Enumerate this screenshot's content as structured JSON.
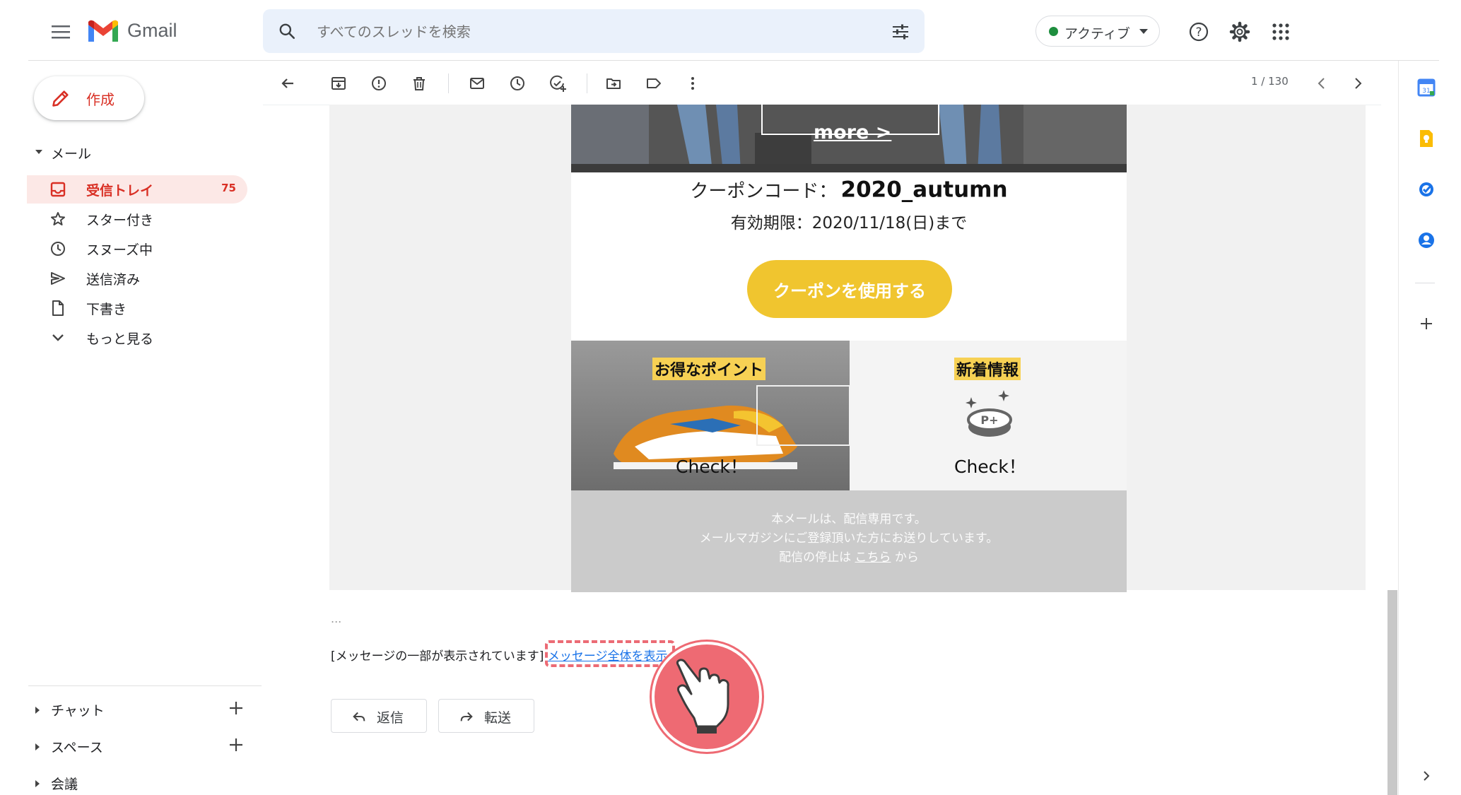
{
  "header": {
    "app_name": "Gmail",
    "search_placeholder": "すべてのスレッドを検索",
    "status_label": "アクティブ"
  },
  "sidebar": {
    "compose_label": "作成",
    "mail_section": "メール",
    "items": [
      {
        "label": "受信トレイ",
        "count": "75",
        "icon": "inbox-icon"
      },
      {
        "label": "スター付き",
        "icon": "star-icon"
      },
      {
        "label": "スヌーズ中",
        "icon": "clock-icon"
      },
      {
        "label": "送信済み",
        "icon": "send-icon"
      },
      {
        "label": "下書き",
        "icon": "draft-icon"
      },
      {
        "label": "もっと見る",
        "icon": "chevron-down-icon"
      }
    ],
    "sections": [
      {
        "label": "チャット"
      },
      {
        "label": "スペース"
      },
      {
        "label": "会議"
      }
    ]
  },
  "toolbar": {
    "page_count": "1 / 130"
  },
  "email": {
    "hero_more": "more >",
    "coupon_label": "クーポンコード：",
    "coupon_code": "2020_autumn",
    "expiry": "有効期限：2020/11/18(日)まで",
    "use_coupon": "クーポンを使用する",
    "promo_left_title": "お得なポイント",
    "promo_left_check": "Check！",
    "promo_right_title": "新着情報",
    "promo_right_check": "Check！",
    "footer_line1": "本メールは、配信専用です。",
    "footer_line2": "メールマガジンにご登録頂いた方にお送りしています。",
    "footer_line3_pre": "配信の停止は",
    "footer_link": "こちら",
    "footer_line3_post": "から"
  },
  "message": {
    "ellipsis": "...",
    "truncated_text": "[メッセージの一部が表示されています]",
    "view_full_link": "メッセージ全体を表示",
    "reply_label": "返信",
    "forward_label": "転送"
  },
  "colors": {
    "accent_red": "#d93025",
    "coupon_button": "#f0c52f",
    "highlight": "#ee6a73",
    "link": "#1a73e8"
  }
}
